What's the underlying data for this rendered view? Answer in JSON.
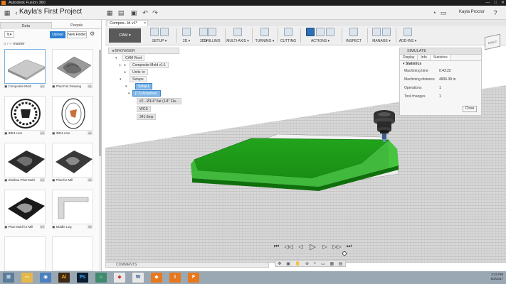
{
  "window": {
    "title": "Autodesk Fusion 360",
    "min": "—",
    "max": "□",
    "close": "✕"
  },
  "appbar": {
    "project_title": "Kayla's First Project",
    "user": "Kayla Proctor"
  },
  "datapanel": {
    "tabs": [
      "Data",
      "People"
    ],
    "upload_label": "Upload",
    "new_folder_label": "New Folder",
    "breadcrumb": "master",
    "items": [
      {
        "name": "Composite Mold",
        "version": "V1"
      },
      {
        "name": "Phat Foil Drawing",
        "version": "V1"
      },
      {
        "name": "IDE4.com",
        "version": "V1"
      },
      {
        "name": "IDE4.com",
        "version": "V1"
      },
      {
        "name": "Shallow Phat Mold",
        "version": "V1"
      },
      {
        "name": "Phat for Mill",
        "version": "V1"
      },
      {
        "name": "Phat Mold for Mill",
        "version": "V1"
      },
      {
        "name": "Middle Leg",
        "version": "V1"
      }
    ]
  },
  "doc_tab": {
    "label": "Compos...ld v1*",
    "close": "×"
  },
  "toolbar": {
    "workspace": "CAM ▾",
    "groups": [
      "SETUP ▾",
      "2D ▾",
      "3D ▾",
      "DRILLING",
      "MULTI-AXIS ▾",
      "TURNING ▾",
      "CUTTING",
      "ACTIONS ▾",
      "INSPECT",
      "MANAGE ▾",
      "ADD-INS ▾"
    ]
  },
  "browser": {
    "header": "BROWSER",
    "nodes": {
      "root": "CAM Root",
      "document": "Composite Mold v1:1",
      "units": "Units: in",
      "setups": "Setups",
      "setup1": "Setup1",
      "adaptive": "[T2] Adaptive1",
      "tool": "#2 - Ø1/4\" flat (1/4\" Fla...",
      "wcs": "WCS",
      "stock": "341.6mp"
    }
  },
  "simulate": {
    "title": "SIMULATE",
    "tabs": [
      "Display",
      "Info",
      "Statistics"
    ],
    "section": "Statistics",
    "stats": [
      {
        "label": "Machining time",
        "value": "0:42:22"
      },
      {
        "label": "Machining distance",
        "value": "4906.39 in"
      },
      {
        "label": "Operations",
        "value": "1"
      },
      {
        "label": "Tool changes",
        "value": "1"
      }
    ],
    "close_label": "Close"
  },
  "viewcube": {
    "label": "RIGHT"
  },
  "comments": {
    "label": "COMMENTS"
  },
  "taskbar": {
    "time": "3:32 PM",
    "date": "5/2/2017"
  },
  "colors": {
    "toolbar_accent": "#2d6fb3",
    "part_green": "#1f9e1a",
    "taskbar": "#9aa8b4"
  }
}
